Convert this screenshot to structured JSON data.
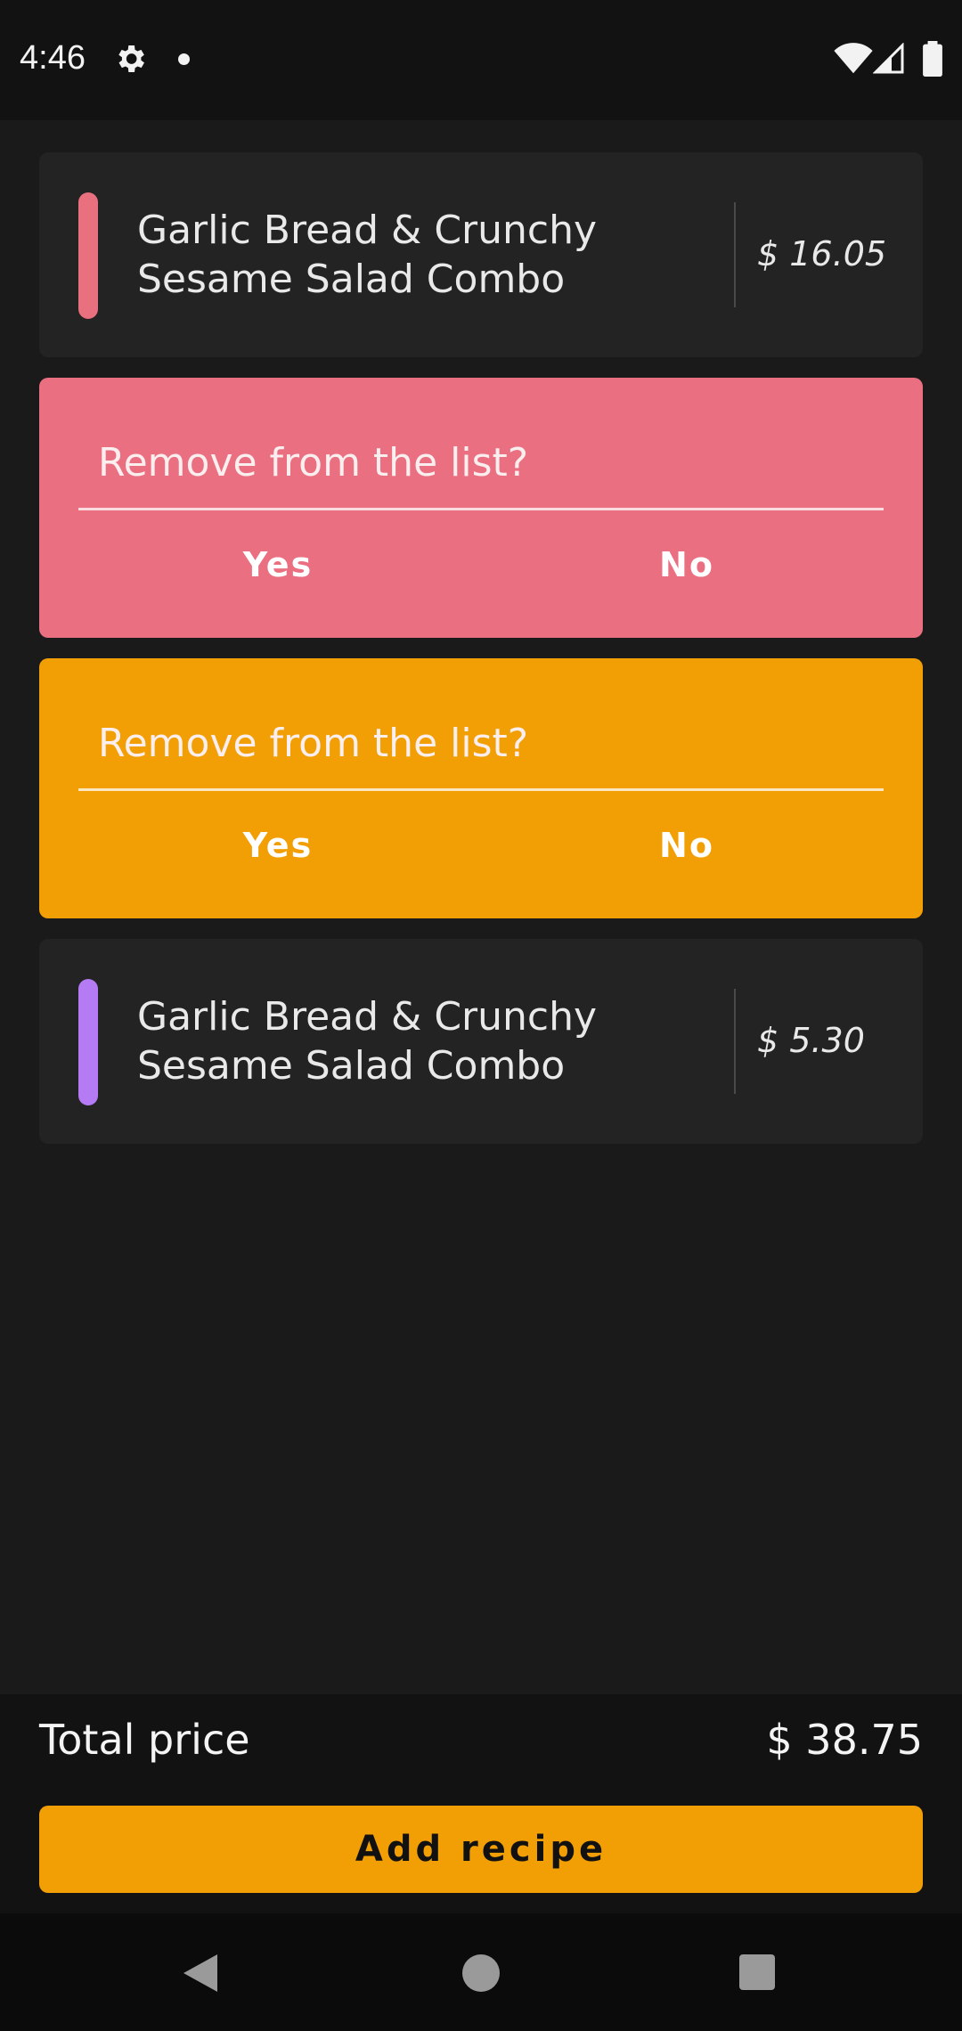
{
  "status_bar": {
    "time": "4:46",
    "icons": [
      "gear-icon",
      "notification-dot-icon",
      "wifi-icon",
      "signal-icon",
      "battery-icon"
    ]
  },
  "items": [
    {
      "name": "Garlic Bread & Crunchy Sesame Salad Combo",
      "price": "$ 16.05",
      "accent_color": "#e8707f"
    },
    {
      "name": "Garlic Bread & Crunchy Sesame Salad Combo",
      "price": "$ 5.30",
      "accent_color": "#b57bf5"
    }
  ],
  "confirmations": [
    {
      "question": "Remove from the list?",
      "yes_label": "Yes",
      "no_label": "No",
      "color": "#ea6f81"
    },
    {
      "question": "Remove from the list?",
      "yes_label": "Yes",
      "no_label": "No",
      "color": "#f29f05"
    }
  ],
  "footer": {
    "total_label": "Total price",
    "total_value": "$ 38.75",
    "add_button_label": "Add recipe"
  },
  "nav_bar": {
    "icons": [
      "back-icon",
      "home-icon",
      "recents-icon"
    ]
  },
  "colors": {
    "background": "#1a1a1a",
    "card": "#232323",
    "accent": "#f29f05",
    "danger": "#ea6f81"
  }
}
